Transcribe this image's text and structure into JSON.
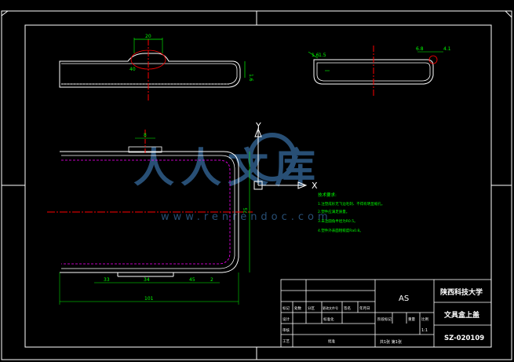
{
  "palette": {
    "background": "#000000",
    "linework": "#ffffff",
    "dimension": "#00ff00",
    "centerline": "#ff0000",
    "hidden_line": "#ff00ff",
    "axis": "#ffffff",
    "watermark": "#2f5d8a"
  },
  "drawing": {
    "front_view": {
      "dim_width": "20",
      "dim_radius": "40",
      "dim_height": "1.6"
    },
    "side_view": {
      "dim_top_left": "1.6",
      "dim_top_right": "1.5",
      "dim_right_a": "6.8",
      "dim_right_b": "4.1"
    },
    "plan_view": {
      "dim_tab": "8",
      "dim_height": "75",
      "dim_bottom_a": "33",
      "dim_bottom_b": "34",
      "dim_bottom_c": "45",
      "dim_bottom_d": "2",
      "dim_overall": "101"
    },
    "ucs": {
      "y_label": "Y",
      "x_label": "X"
    },
    "tech_notes": {
      "heading": "技术要求:",
      "lines": [
        "1.注塑成形无飞边毛刺、不得有明显缩孔。",
        "2.塑件应满足质量。",
        "3.未注圆角半径为R0.5。",
        "4.塑件外表面粗糙度Ra0.8。"
      ]
    }
  },
  "title_block": {
    "material": "AS",
    "school": "陕西科技大学",
    "part_name": "文具盒上盖",
    "drawing_no": "SZ-020109",
    "scale": "1:1",
    "sheet": "共1张 第1张",
    "labels": {
      "mark": "标记",
      "count": "处数",
      "zone": "分区",
      "change_doc": "更改文件号",
      "sign": "签名",
      "date": "年月日",
      "designer": "设计",
      "standardize": "标准化",
      "check": "审核",
      "process": "工艺",
      "approve": "批准",
      "stage": "阶段标记",
      "weight": "重量",
      "ratio": "比例"
    }
  },
  "watermark": {
    "brand": "人人文库",
    "url": "www.renrendoc.com"
  }
}
